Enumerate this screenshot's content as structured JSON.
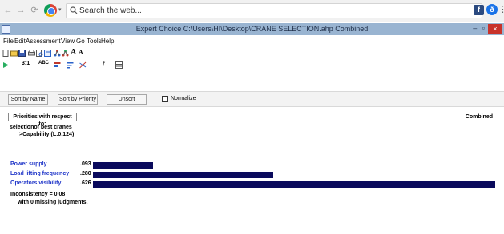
{
  "browser": {
    "back": "←",
    "forward": "→",
    "reload": "⟳",
    "search_placeholder": "Search the web...",
    "ext1": "f",
    "ext2": "ð",
    "menu": "⋮"
  },
  "window": {
    "title": "Expert Choice    C:\\Users\\HI\\Desktop\\CRANE SELECTION.ahp    Combined",
    "minimize_maximize": "– ▫",
    "close": "×"
  },
  "menu": [
    "File",
    "Edit",
    "Assessment",
    "View",
    "Go",
    "Tools",
    "Help"
  ],
  "sort": {
    "by_name": "Sort by Name",
    "by_priority": "Sort by Priority",
    "unsort": "Unsort",
    "normalize": "Normalize"
  },
  "main": {
    "priorities_label": "Priorities with respect to:",
    "combined": "Combined",
    "goal": "selectionof best cranes",
    "node": ">Capability (L:0.124)",
    "inconsistency": "Inconsistency = 0.08",
    "missing": "with 0  missing judgments."
  },
  "chart_data": {
    "type": "bar",
    "orientation": "horizontal",
    "categories": [
      "Power supply",
      "Load lifting frequency",
      "Operators visibility"
    ],
    "values": [
      0.093,
      0.28,
      0.626
    ],
    "value_labels": [
      ".093",
      ".280",
      ".626"
    ],
    "bar_color": "#0a0a5c",
    "label_color": "#1f35c8",
    "xlim": [
      0,
      0.626
    ]
  }
}
